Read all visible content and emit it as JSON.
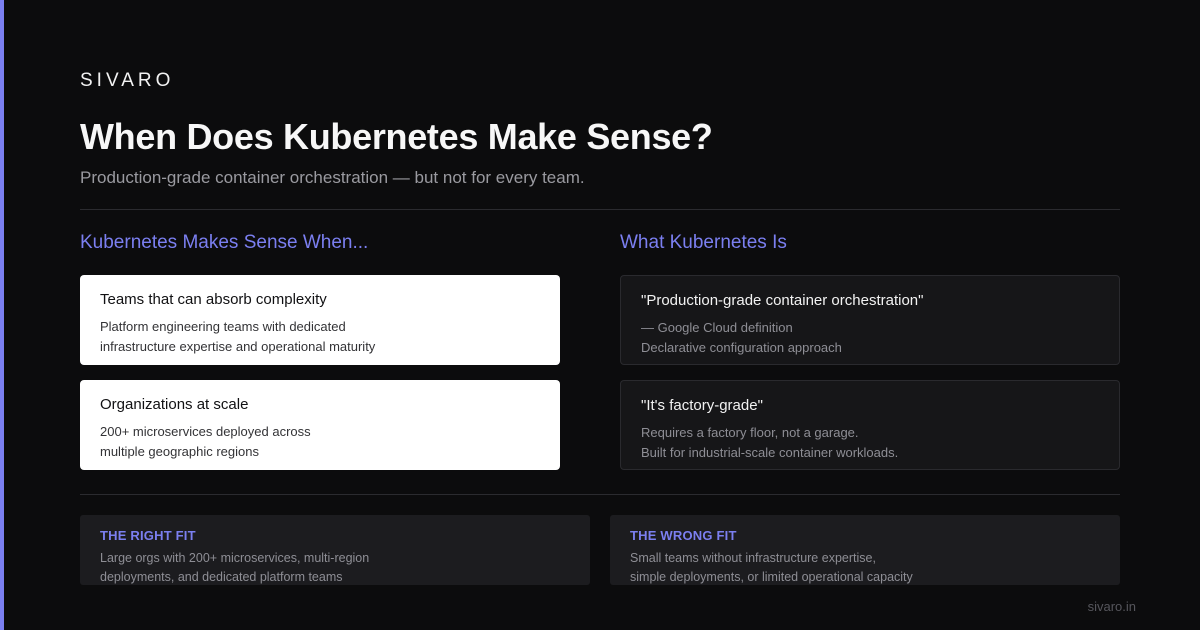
{
  "brand": "SIVARO",
  "title": "When Does Kubernetes Make Sense?",
  "subtitle": "Production-grade container orchestration — but not for every team.",
  "left_column": {
    "heading": "Kubernetes Makes Sense When...",
    "cards": [
      {
        "title": "Teams that can absorb complexity",
        "lines": [
          "Platform engineering teams with dedicated",
          "infrastructure expertise and operational maturity"
        ]
      },
      {
        "title": "Organizations at scale",
        "lines": [
          "200+ microservices deployed across",
          "multiple geographic regions"
        ]
      }
    ]
  },
  "right_column": {
    "heading": "What Kubernetes Is",
    "cards": [
      {
        "title": "\"Production-grade container orchestration\"",
        "lines": [
          "— Google Cloud definition",
          "Declarative configuration approach"
        ]
      },
      {
        "title": "\"It's factory-grade\"",
        "lines": [
          "Requires a factory floor, not a garage.",
          "Built for industrial-scale container workloads."
        ]
      }
    ]
  },
  "fit": {
    "right": {
      "label": "THE RIGHT FIT",
      "lines": [
        "Large orgs with 200+ microservices, multi-region",
        "deployments, and dedicated platform teams"
      ]
    },
    "wrong": {
      "label": "THE WRONG FIT",
      "lines": [
        "Small teams without infrastructure expertise,",
        "simple deployments, or limited operational capacity"
      ]
    }
  },
  "footer": "sivaro.in",
  "colors": {
    "accent": "#7b7ff0",
    "background": "#0c0c0d",
    "card_light": "#ffffff",
    "card_dark": "#161618"
  }
}
